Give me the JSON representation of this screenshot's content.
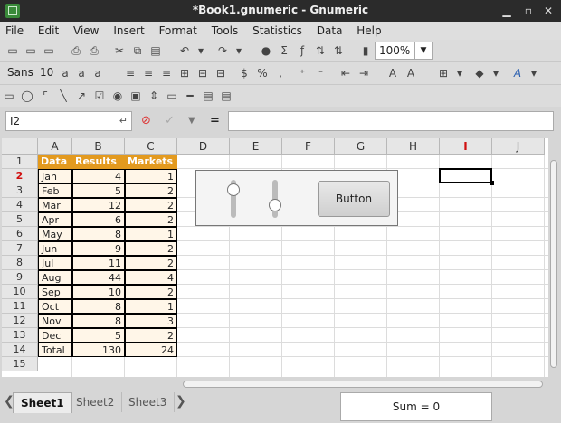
{
  "window": {
    "title": "*Book1.gnumeric - Gnumeric"
  },
  "menu": [
    "File",
    "Edit",
    "View",
    "Insert",
    "Format",
    "Tools",
    "Statistics",
    "Data",
    "Help"
  ],
  "toolbar": {
    "zoom": "100%"
  },
  "format_bar": {
    "font_name": "Sans",
    "font_size": "10"
  },
  "formula_bar": {
    "cell_ref": "I2",
    "equals": "=",
    "content": ""
  },
  "columns": [
    "A",
    "B",
    "C",
    "D",
    "E",
    "F",
    "G",
    "H",
    "I",
    "J"
  ],
  "rows": [
    "1",
    "2",
    "3",
    "4",
    "5",
    "6",
    "7",
    "8",
    "9",
    "10",
    "11",
    "12",
    "13",
    "14",
    "15"
  ],
  "selected": {
    "col": "I",
    "row": "2"
  },
  "table": {
    "headers": [
      "Data",
      "Results",
      "Markets"
    ],
    "rows": [
      [
        "Jan",
        "4",
        "1"
      ],
      [
        "Feb",
        "5",
        "2"
      ],
      [
        "Mar",
        "12",
        "2"
      ],
      [
        "Apr",
        "6",
        "2"
      ],
      [
        "May",
        "8",
        "1"
      ],
      [
        "Jun",
        "9",
        "2"
      ],
      [
        "Jul",
        "11",
        "2"
      ],
      [
        "Aug",
        "44",
        "4"
      ],
      [
        "Sep",
        "10",
        "2"
      ],
      [
        "Oct",
        "8",
        "1"
      ],
      [
        "Nov",
        "8",
        "3"
      ],
      [
        "Dec",
        "5",
        "2"
      ],
      [
        "Total",
        "130",
        "24"
      ]
    ]
  },
  "widget": {
    "button_label": "Button",
    "slider1_level": 0.15,
    "slider2_level": 0.75
  },
  "sheets": [
    "Sheet1",
    "Sheet2",
    "Sheet3"
  ],
  "status": {
    "sum": "Sum = 0"
  }
}
